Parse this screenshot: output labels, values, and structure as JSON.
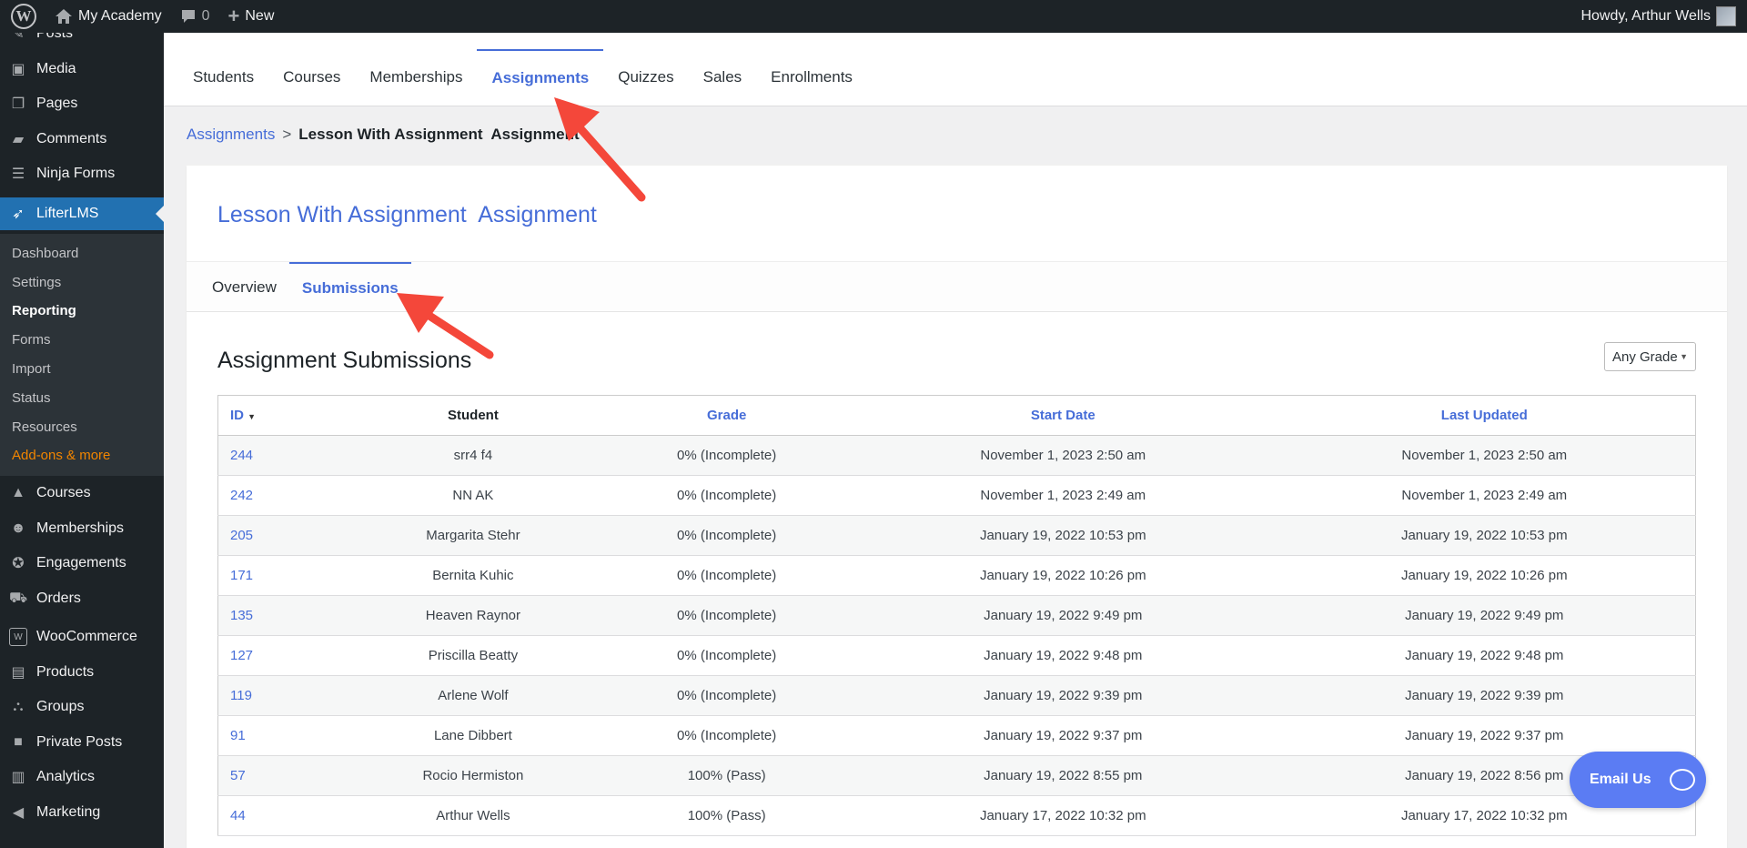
{
  "adminbar": {
    "site_name": "My Academy",
    "comments_count": "0",
    "new_label": "New",
    "greeting": "Howdy, Arthur Wells"
  },
  "sidebar": {
    "items_top": [
      {
        "label": "Posts",
        "icon": "pin-icon"
      },
      {
        "label": "Media",
        "icon": "media-icon"
      },
      {
        "label": "Pages",
        "icon": "pages-icon"
      },
      {
        "label": "Comments",
        "icon": "comment-icon"
      },
      {
        "label": "Ninja Forms",
        "icon": "forms-icon"
      }
    ],
    "active": {
      "label": "LifterLMS",
      "icon": "rocket-icon"
    },
    "submenu": [
      "Dashboard",
      "Settings",
      "Reporting",
      "Forms",
      "Import",
      "Status",
      "Resources",
      "Add-ons & more"
    ],
    "items_bottom": [
      {
        "label": "Courses",
        "icon": "graduation-cap-icon"
      },
      {
        "label": "Memberships",
        "icon": "groups-icon"
      },
      {
        "label": "Engagements",
        "icon": "award-icon"
      },
      {
        "label": "Orders",
        "icon": "cart-icon"
      },
      {
        "label": "WooCommerce",
        "icon": "woo-icon"
      },
      {
        "label": "Products",
        "icon": "archive-icon"
      },
      {
        "label": "Groups",
        "icon": "network-icon"
      },
      {
        "label": "Private Posts",
        "icon": "lock-icon"
      },
      {
        "label": "Analytics",
        "icon": "chart-icon"
      },
      {
        "label": "Marketing",
        "icon": "megaphone-icon"
      }
    ]
  },
  "topnav": [
    "Students",
    "Courses",
    "Memberships",
    "Assignments",
    "Quizzes",
    "Sales",
    "Enrollments"
  ],
  "breadcrumb": {
    "parent": "Assignments",
    "separator": ">",
    "current": "Lesson With Assignment  Assignment"
  },
  "card": {
    "title": "Lesson With Assignment  Assignment",
    "subtabs": [
      "Overview",
      "Submissions"
    ],
    "section_title": "Assignment Submissions",
    "grade_filter": "Any Grade"
  },
  "table": {
    "columns": [
      "ID",
      "Student",
      "Grade",
      "Start Date",
      "Last Updated"
    ],
    "rows": [
      [
        "244",
        "srr4 f4",
        "0% (Incomplete)",
        "November 1, 2023 2:50 am",
        "November 1, 2023 2:50 am"
      ],
      [
        "242",
        "NN AK",
        "0% (Incomplete)",
        "November 1, 2023 2:49 am",
        "November 1, 2023 2:49 am"
      ],
      [
        "205",
        "Margarita Stehr",
        "0% (Incomplete)",
        "January 19, 2022 10:53 pm",
        "January 19, 2022 10:53 pm"
      ],
      [
        "171",
        "Bernita Kuhic",
        "0% (Incomplete)",
        "January 19, 2022 10:26 pm",
        "January 19, 2022 10:26 pm"
      ],
      [
        "135",
        "Heaven Raynor",
        "0% (Incomplete)",
        "January 19, 2022 9:49 pm",
        "January 19, 2022 9:49 pm"
      ],
      [
        "127",
        "Priscilla Beatty",
        "0% (Incomplete)",
        "January 19, 2022 9:48 pm",
        "January 19, 2022 9:48 pm"
      ],
      [
        "119",
        "Arlene Wolf",
        "0% (Incomplete)",
        "January 19, 2022 9:39 pm",
        "January 19, 2022 9:39 pm"
      ],
      [
        "91",
        "Lane Dibbert",
        "0% (Incomplete)",
        "January 19, 2022 9:37 pm",
        "January 19, 2022 9:37 pm"
      ],
      [
        "57",
        "Rocio Hermiston",
        "100% (Pass)",
        "January 19, 2022 8:55 pm",
        "January 19, 2022 8:56 pm"
      ],
      [
        "44",
        "Arthur Wells",
        "100% (Pass)",
        "January 17, 2022 10:32 pm",
        "January 17, 2022 10:32 pm"
      ]
    ]
  },
  "email_us": "Email Us",
  "colors": {
    "accent": "#466dd8",
    "wp_dark": "#1d2327",
    "wp_blue": "#2271b1",
    "arrow": "#f4473a"
  }
}
